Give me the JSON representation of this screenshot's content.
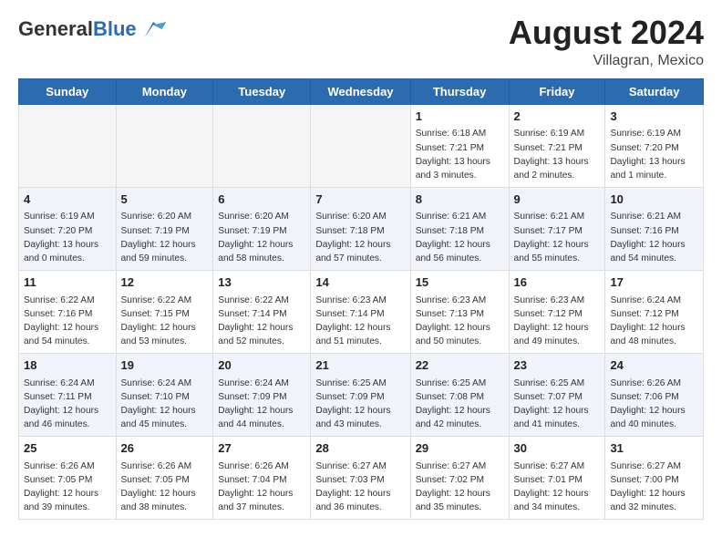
{
  "header": {
    "logo_line1": "General",
    "logo_line2": "Blue",
    "month_year": "August 2024",
    "location": "Villagran, Mexico"
  },
  "days_of_week": [
    "Sunday",
    "Monday",
    "Tuesday",
    "Wednesday",
    "Thursday",
    "Friday",
    "Saturday"
  ],
  "weeks": [
    [
      {
        "day": "",
        "info": ""
      },
      {
        "day": "",
        "info": ""
      },
      {
        "day": "",
        "info": ""
      },
      {
        "day": "",
        "info": ""
      },
      {
        "day": "1",
        "info": "Sunrise: 6:18 AM\nSunset: 7:21 PM\nDaylight: 13 hours\nand 3 minutes."
      },
      {
        "day": "2",
        "info": "Sunrise: 6:19 AM\nSunset: 7:21 PM\nDaylight: 13 hours\nand 2 minutes."
      },
      {
        "day": "3",
        "info": "Sunrise: 6:19 AM\nSunset: 7:20 PM\nDaylight: 13 hours\nand 1 minute."
      }
    ],
    [
      {
        "day": "4",
        "info": "Sunrise: 6:19 AM\nSunset: 7:20 PM\nDaylight: 13 hours\nand 0 minutes."
      },
      {
        "day": "5",
        "info": "Sunrise: 6:20 AM\nSunset: 7:19 PM\nDaylight: 12 hours\nand 59 minutes."
      },
      {
        "day": "6",
        "info": "Sunrise: 6:20 AM\nSunset: 7:19 PM\nDaylight: 12 hours\nand 58 minutes."
      },
      {
        "day": "7",
        "info": "Sunrise: 6:20 AM\nSunset: 7:18 PM\nDaylight: 12 hours\nand 57 minutes."
      },
      {
        "day": "8",
        "info": "Sunrise: 6:21 AM\nSunset: 7:18 PM\nDaylight: 12 hours\nand 56 minutes."
      },
      {
        "day": "9",
        "info": "Sunrise: 6:21 AM\nSunset: 7:17 PM\nDaylight: 12 hours\nand 55 minutes."
      },
      {
        "day": "10",
        "info": "Sunrise: 6:21 AM\nSunset: 7:16 PM\nDaylight: 12 hours\nand 54 minutes."
      }
    ],
    [
      {
        "day": "11",
        "info": "Sunrise: 6:22 AM\nSunset: 7:16 PM\nDaylight: 12 hours\nand 54 minutes."
      },
      {
        "day": "12",
        "info": "Sunrise: 6:22 AM\nSunset: 7:15 PM\nDaylight: 12 hours\nand 53 minutes."
      },
      {
        "day": "13",
        "info": "Sunrise: 6:22 AM\nSunset: 7:14 PM\nDaylight: 12 hours\nand 52 minutes."
      },
      {
        "day": "14",
        "info": "Sunrise: 6:23 AM\nSunset: 7:14 PM\nDaylight: 12 hours\nand 51 minutes."
      },
      {
        "day": "15",
        "info": "Sunrise: 6:23 AM\nSunset: 7:13 PM\nDaylight: 12 hours\nand 50 minutes."
      },
      {
        "day": "16",
        "info": "Sunrise: 6:23 AM\nSunset: 7:12 PM\nDaylight: 12 hours\nand 49 minutes."
      },
      {
        "day": "17",
        "info": "Sunrise: 6:24 AM\nSunset: 7:12 PM\nDaylight: 12 hours\nand 48 minutes."
      }
    ],
    [
      {
        "day": "18",
        "info": "Sunrise: 6:24 AM\nSunset: 7:11 PM\nDaylight: 12 hours\nand 46 minutes."
      },
      {
        "day": "19",
        "info": "Sunrise: 6:24 AM\nSunset: 7:10 PM\nDaylight: 12 hours\nand 45 minutes."
      },
      {
        "day": "20",
        "info": "Sunrise: 6:24 AM\nSunset: 7:09 PM\nDaylight: 12 hours\nand 44 minutes."
      },
      {
        "day": "21",
        "info": "Sunrise: 6:25 AM\nSunset: 7:09 PM\nDaylight: 12 hours\nand 43 minutes."
      },
      {
        "day": "22",
        "info": "Sunrise: 6:25 AM\nSunset: 7:08 PM\nDaylight: 12 hours\nand 42 minutes."
      },
      {
        "day": "23",
        "info": "Sunrise: 6:25 AM\nSunset: 7:07 PM\nDaylight: 12 hours\nand 41 minutes."
      },
      {
        "day": "24",
        "info": "Sunrise: 6:26 AM\nSunset: 7:06 PM\nDaylight: 12 hours\nand 40 minutes."
      }
    ],
    [
      {
        "day": "25",
        "info": "Sunrise: 6:26 AM\nSunset: 7:05 PM\nDaylight: 12 hours\nand 39 minutes."
      },
      {
        "day": "26",
        "info": "Sunrise: 6:26 AM\nSunset: 7:05 PM\nDaylight: 12 hours\nand 38 minutes."
      },
      {
        "day": "27",
        "info": "Sunrise: 6:26 AM\nSunset: 7:04 PM\nDaylight: 12 hours\nand 37 minutes."
      },
      {
        "day": "28",
        "info": "Sunrise: 6:27 AM\nSunset: 7:03 PM\nDaylight: 12 hours\nand 36 minutes."
      },
      {
        "day": "29",
        "info": "Sunrise: 6:27 AM\nSunset: 7:02 PM\nDaylight: 12 hours\nand 35 minutes."
      },
      {
        "day": "30",
        "info": "Sunrise: 6:27 AM\nSunset: 7:01 PM\nDaylight: 12 hours\nand 34 minutes."
      },
      {
        "day": "31",
        "info": "Sunrise: 6:27 AM\nSunset: 7:00 PM\nDaylight: 12 hours\nand 32 minutes."
      }
    ]
  ]
}
